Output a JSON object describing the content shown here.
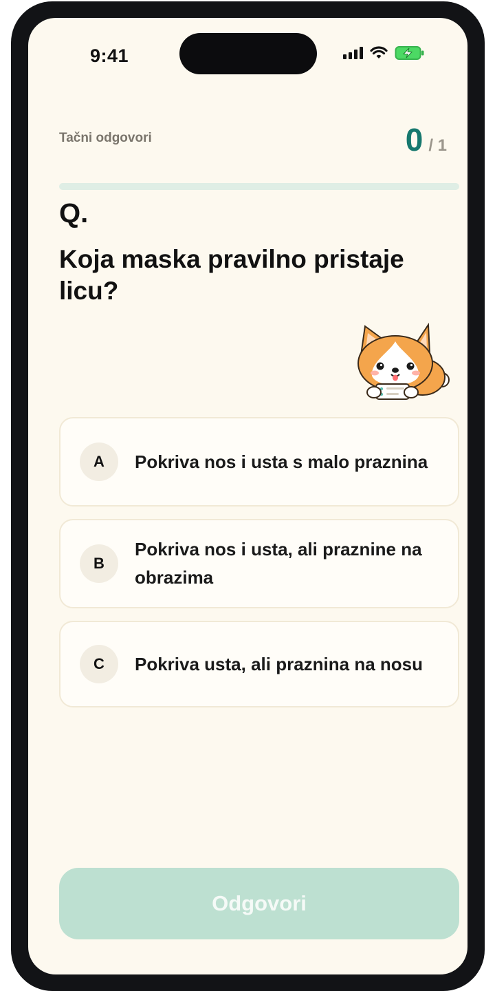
{
  "status_bar": {
    "time": "9:41"
  },
  "header": {
    "score_label": "Tačni odgovori",
    "score_current": "0",
    "score_total": "/ 1",
    "progress": 0
  },
  "question": {
    "marker": "Q.",
    "text": "Koja maska pravilno pristaje licu?"
  },
  "options": [
    {
      "letter": "A",
      "text": "Pokriva nos i usta s malo praznina"
    },
    {
      "letter": "B",
      "text": "Pokriva nos i usta, ali praznine na obrazima"
    },
    {
      "letter": "C",
      "text": "Pokriva usta, ali praznina na nosu"
    }
  ],
  "submit": {
    "label": "Odgovori"
  },
  "colors": {
    "accent": "#16786e",
    "background": "#fdf9ef",
    "button_disabled": "#bde0d1"
  },
  "icons": {
    "signal": "cellular-signal-icon",
    "wifi": "wifi-icon",
    "battery": "battery-charging-icon",
    "mascot": "corgi-mascot-illustration"
  }
}
